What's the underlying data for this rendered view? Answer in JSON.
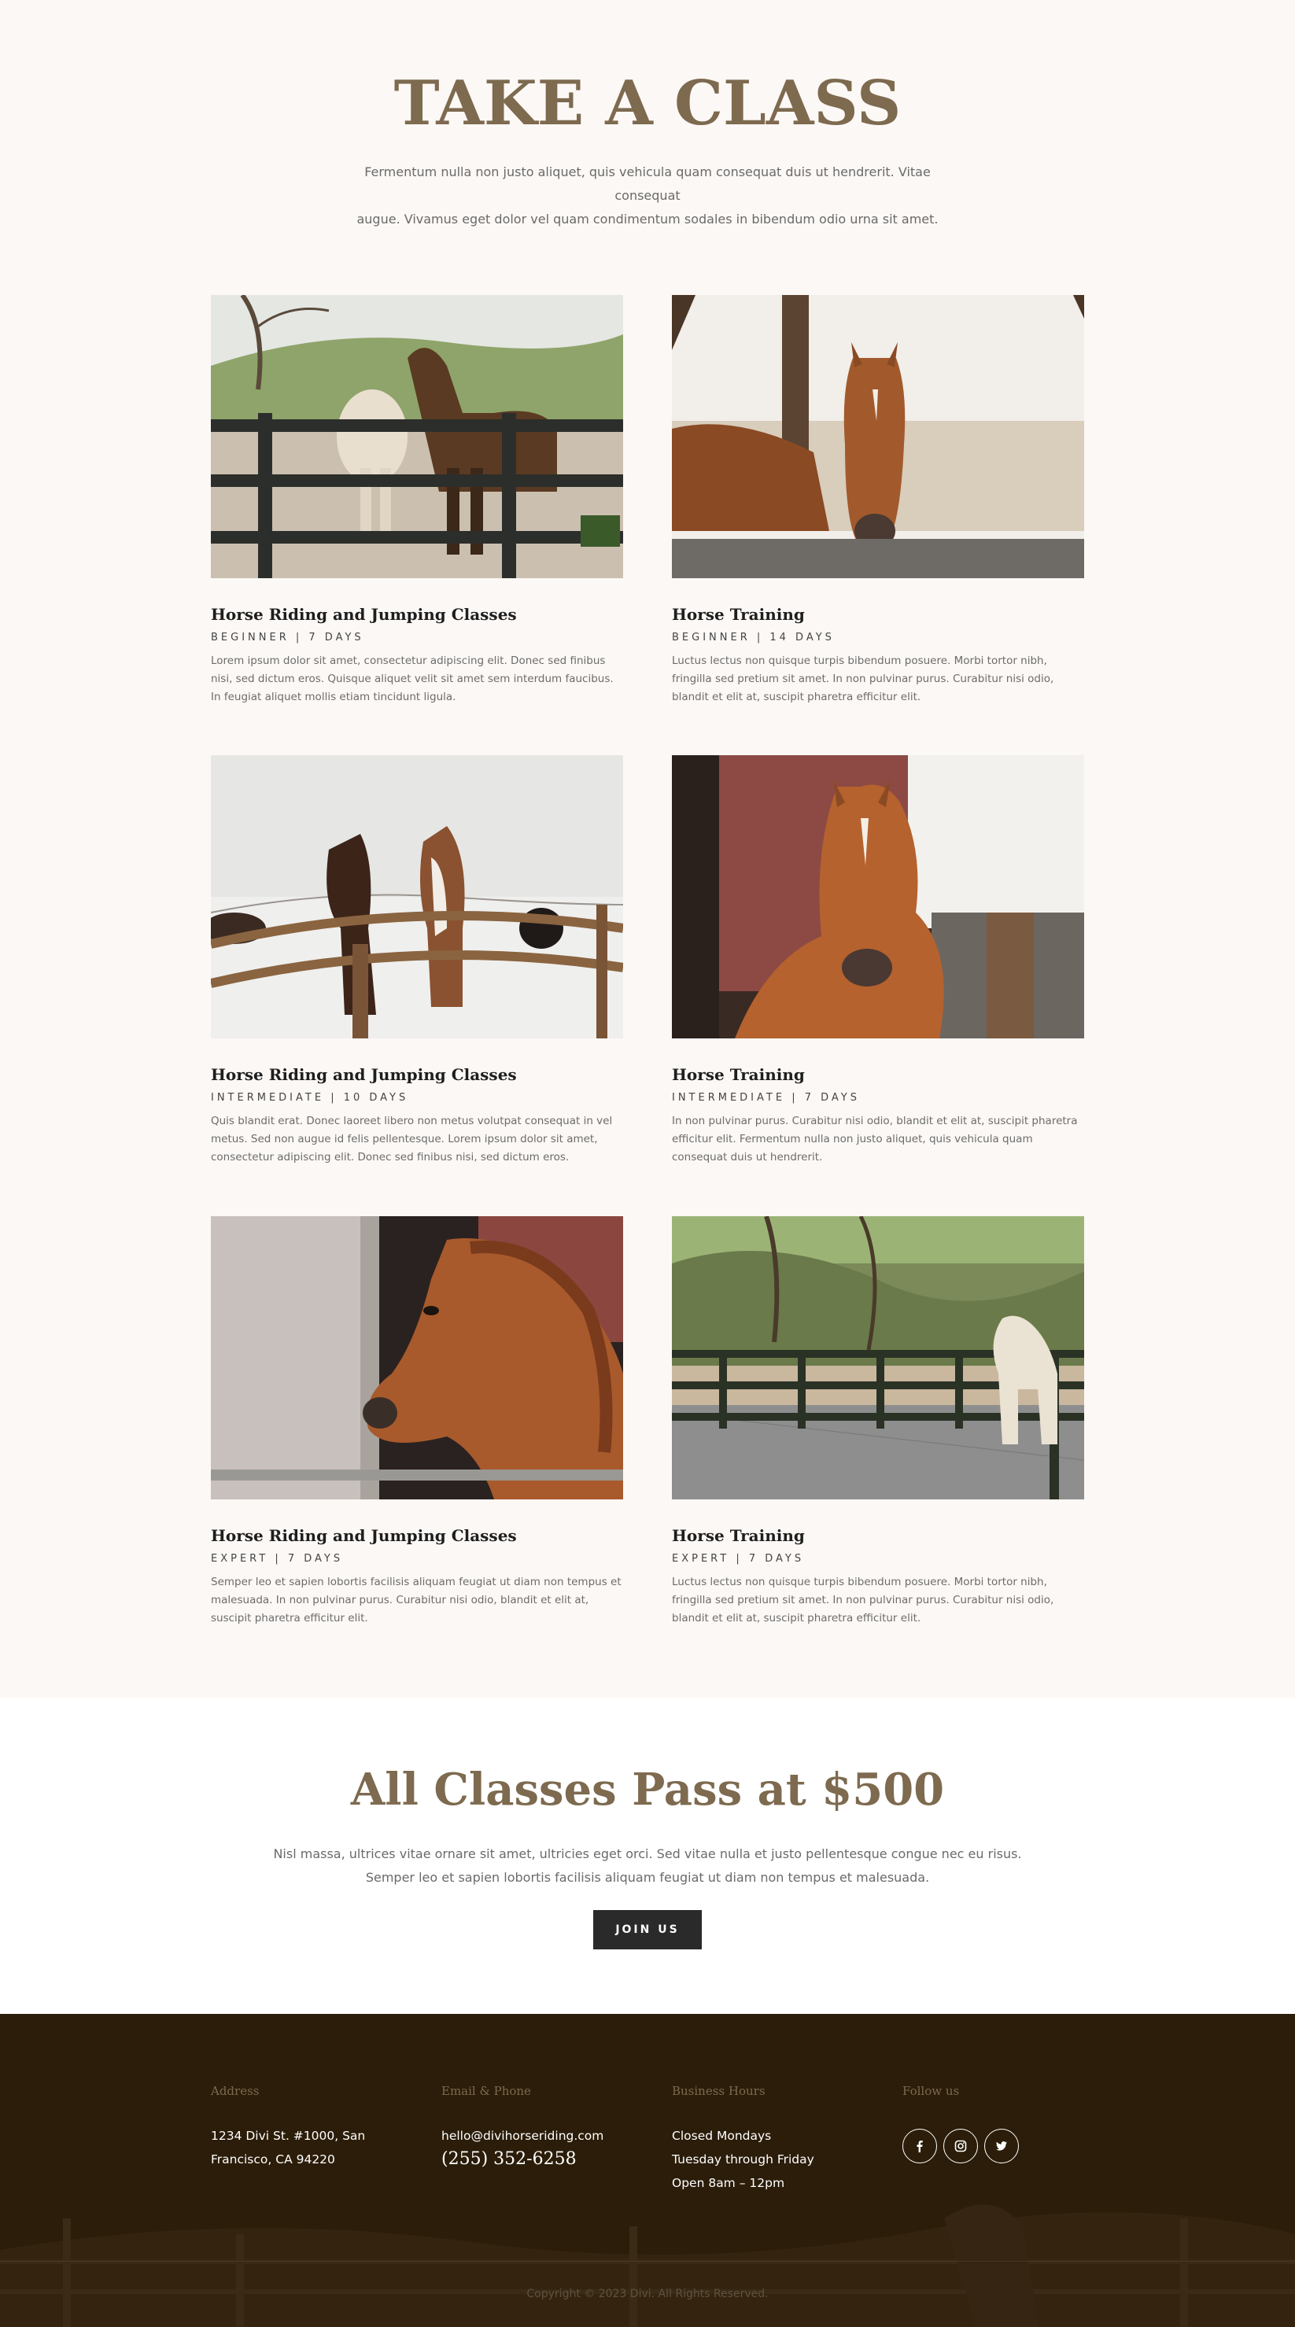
{
  "classes": {
    "title": "TAKE A CLASS",
    "intro_line1": "Fermentum nulla non justo aliquet, quis vehicula quam consequat duis ut hendrerit. Vitae consequat",
    "intro_line2": "augue. Vivamus eget dolor vel quam condimentum sodales in bibendum odio urna sit amet.",
    "cards": [
      {
        "title": "Horse Riding and Jumping Classes",
        "meta": "BEGINNER | 7 DAYS",
        "text": "Lorem ipsum dolor sit amet, consectetur adipiscing elit. Donec sed finibus nisi, sed dictum eros. Quisque aliquet velit sit amet sem interdum faucibus. In feugiat aliquet mollis etiam tincidunt ligula.",
        "image": "two-horses-at-fence-photo"
      },
      {
        "title": "Horse Training",
        "meta": "BEGINNER | 14 DAYS",
        "text": "Luctus lectus non quisque turpis bibendum posuere. Morbi tortor nibh, fringilla sed pretium sit amet. In non pulvinar purus. Curabitur nisi odio, blandit et elit at, suscipit pharetra efficitur elit.",
        "image": "chestnut-horse-in-stable-photo"
      },
      {
        "title": "Horse Riding and Jumping Classes",
        "meta": "INTERMEDIATE | 10 DAYS",
        "text": "Quis blandit erat. Donec laoreet libero non metus volutpat consequat in vel metus. Sed non augue id felis pellentesque. Lorem ipsum dolor sit amet, consectetur adipiscing elit. Donec sed finibus nisi, sed dictum eros.",
        "image": "horses-in-snow-photo"
      },
      {
        "title": "Horse Training",
        "meta": "INTERMEDIATE | 7 DAYS",
        "text": "In non pulvinar purus. Curabitur nisi odio, blandit et elit at, suscipit pharetra efficitur elit. Fermentum nulla non justo aliquet, quis vehicula quam consequat duis ut hendrerit.",
        "image": "chestnut-horse-by-barn-photo"
      },
      {
        "title": "Horse Riding and Jumping Classes",
        "meta": "EXPERT | 7 DAYS",
        "text": "Semper leo et sapien lobortis facilisis aliquam feugiat ut diam non tempus et malesuada. In non pulvinar purus. Curabitur nisi odio, blandit et elit at, suscipit pharetra efficitur elit.",
        "image": "horse-head-profile-photo"
      },
      {
        "title": "Horse Training",
        "meta": "EXPERT | 7 DAYS",
        "text": "Luctus lectus non quisque turpis bibendum posuere. Morbi tortor nibh, fringilla sed pretium sit amet. In non pulvinar purus. Curabitur nisi odio, blandit et elit at, suscipit pharetra efficitur elit.",
        "image": "white-horse-at-paddock-photo"
      }
    ]
  },
  "pass": {
    "title": "All Classes Pass at $500",
    "text_line1": "Nisl massa, ultrices vitae ornare sit amet, ultricies eget orci. Sed vitae nulla et justo pellentesque congue nec eu risus.",
    "text_line2": "Semper leo et sapien lobortis facilisis aliquam feugiat ut diam non tempus et malesuada.",
    "button_label": "JOIN US"
  },
  "footer": {
    "address": {
      "heading": "Address",
      "line1": "1234 Divi St. #1000, San",
      "line2": "Francisco, CA 94220"
    },
    "contact": {
      "heading": "Email & Phone",
      "email": "hello@divihorseriding.com",
      "phone": "(255) 352-6258"
    },
    "hours": {
      "heading": "Business Hours",
      "line1": "Closed Mondays",
      "line2": "Tuesday through Friday",
      "line3": "Open 8am – 12pm"
    },
    "follow": {
      "heading": "Follow us",
      "icons": [
        "facebook-icon",
        "instagram-icon",
        "twitter-icon"
      ]
    },
    "copyright": "Copyright © 2023 Divi. All Rights Reserved."
  },
  "colors": {
    "accent": "#7d6a4f",
    "page_bg": "#fcf8f5",
    "footer_bg": "#2b1d09",
    "button_bg": "#2a2a2a"
  }
}
